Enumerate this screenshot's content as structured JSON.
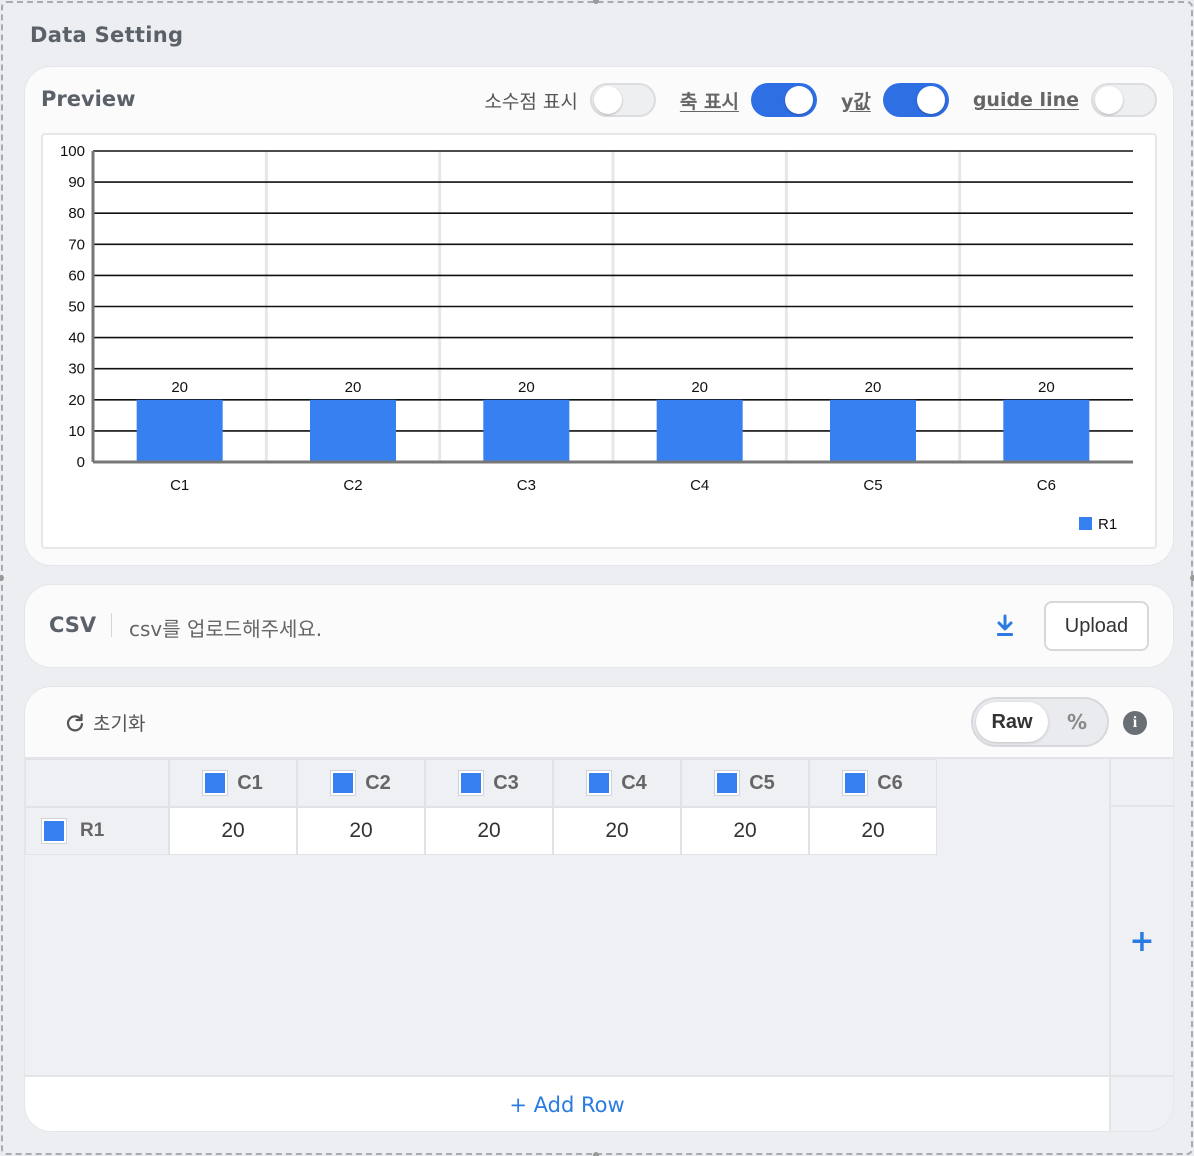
{
  "panel": {
    "title": "Data Setting"
  },
  "preview": {
    "title": "Preview",
    "toggles": [
      {
        "label": "소수점 표시",
        "on": false
      },
      {
        "label": "축 표시",
        "on": true
      },
      {
        "label": "y값",
        "on": true
      },
      {
        "label": "guide line",
        "on": false
      }
    ]
  },
  "chart_data": {
    "type": "bar",
    "categories": [
      "C1",
      "C2",
      "C3",
      "C4",
      "C5",
      "C6"
    ],
    "series": [
      {
        "name": "R1",
        "values": [
          20,
          20,
          20,
          20,
          20,
          20
        ],
        "color": "#3780f1"
      }
    ],
    "ylim": [
      0,
      100
    ],
    "yticks": [
      0,
      10,
      20,
      30,
      40,
      50,
      60,
      70,
      80,
      90,
      100
    ],
    "grid": true,
    "data_labels": true,
    "legend": "bottom-right"
  },
  "csv": {
    "label": "CSV",
    "placeholder": "csv를 업로드해주세요.",
    "download_icon": "download-icon",
    "upload_label": "Upload"
  },
  "grid": {
    "reset_label": "초기화",
    "mode_raw": "Raw",
    "mode_percent": "%",
    "columns": [
      "C1",
      "C2",
      "C3",
      "C4",
      "C5",
      "C6"
    ],
    "rows": [
      {
        "name": "R1",
        "values": [
          "20",
          "20",
          "20",
          "20",
          "20",
          "20"
        ]
      }
    ],
    "add_column_symbol": "+",
    "add_row_label": "+ Add Row",
    "accent": "#2a7ce0"
  }
}
